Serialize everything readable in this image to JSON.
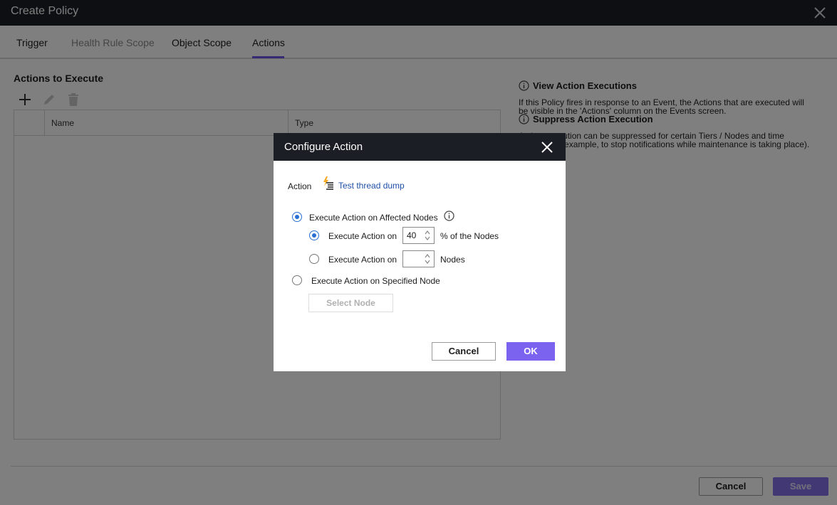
{
  "window": {
    "title": "Create Policy"
  },
  "tabs": [
    {
      "label": "Trigger"
    },
    {
      "label": "Health Rule Scope"
    },
    {
      "label": "Object Scope"
    },
    {
      "label": "Actions"
    }
  ],
  "actions_section": {
    "title": "Actions to Execute",
    "columns": [
      "Name",
      "Type"
    ]
  },
  "right_panel": {
    "view": {
      "title": "View Action Executions",
      "text_line1": "If this Policy fires in response to an Event, the Actions that are executed will",
      "text_line2": "be visible in the 'Actions' column on the Events screen."
    },
    "suppress": {
      "title": "Suppress Action Execution",
      "text_line1": "Action execution can be suppressed for certain Tiers / Nodes and time",
      "text_line2": "periods (for example, to stop notifications while maintenance is taking place)."
    }
  },
  "footer": {
    "cancel_label": "Cancel",
    "save_label": "Save"
  },
  "modal": {
    "title": "Configure Action",
    "action_label": "Action",
    "action_value": "Test thread dump",
    "option_affected": "Execute Action on Affected Nodes",
    "sub_percent_prefix": "Execute Action on",
    "sub_percent_value": "40",
    "sub_percent_suffix": "% of the Nodes",
    "sub_nodes_prefix": "Execute Action on",
    "sub_nodes_value": "",
    "sub_nodes_suffix": "Nodes",
    "option_specified": "Execute Action on Specified Node",
    "select_node_label": "Select Node",
    "cancel_label": "Cancel",
    "ok_label": "OK"
  },
  "colors": {
    "accent": "#6a55e6",
    "radio_selected": "#2a6fd6",
    "link": "#1f4fa8",
    "header_bg": "#1b1e24"
  }
}
